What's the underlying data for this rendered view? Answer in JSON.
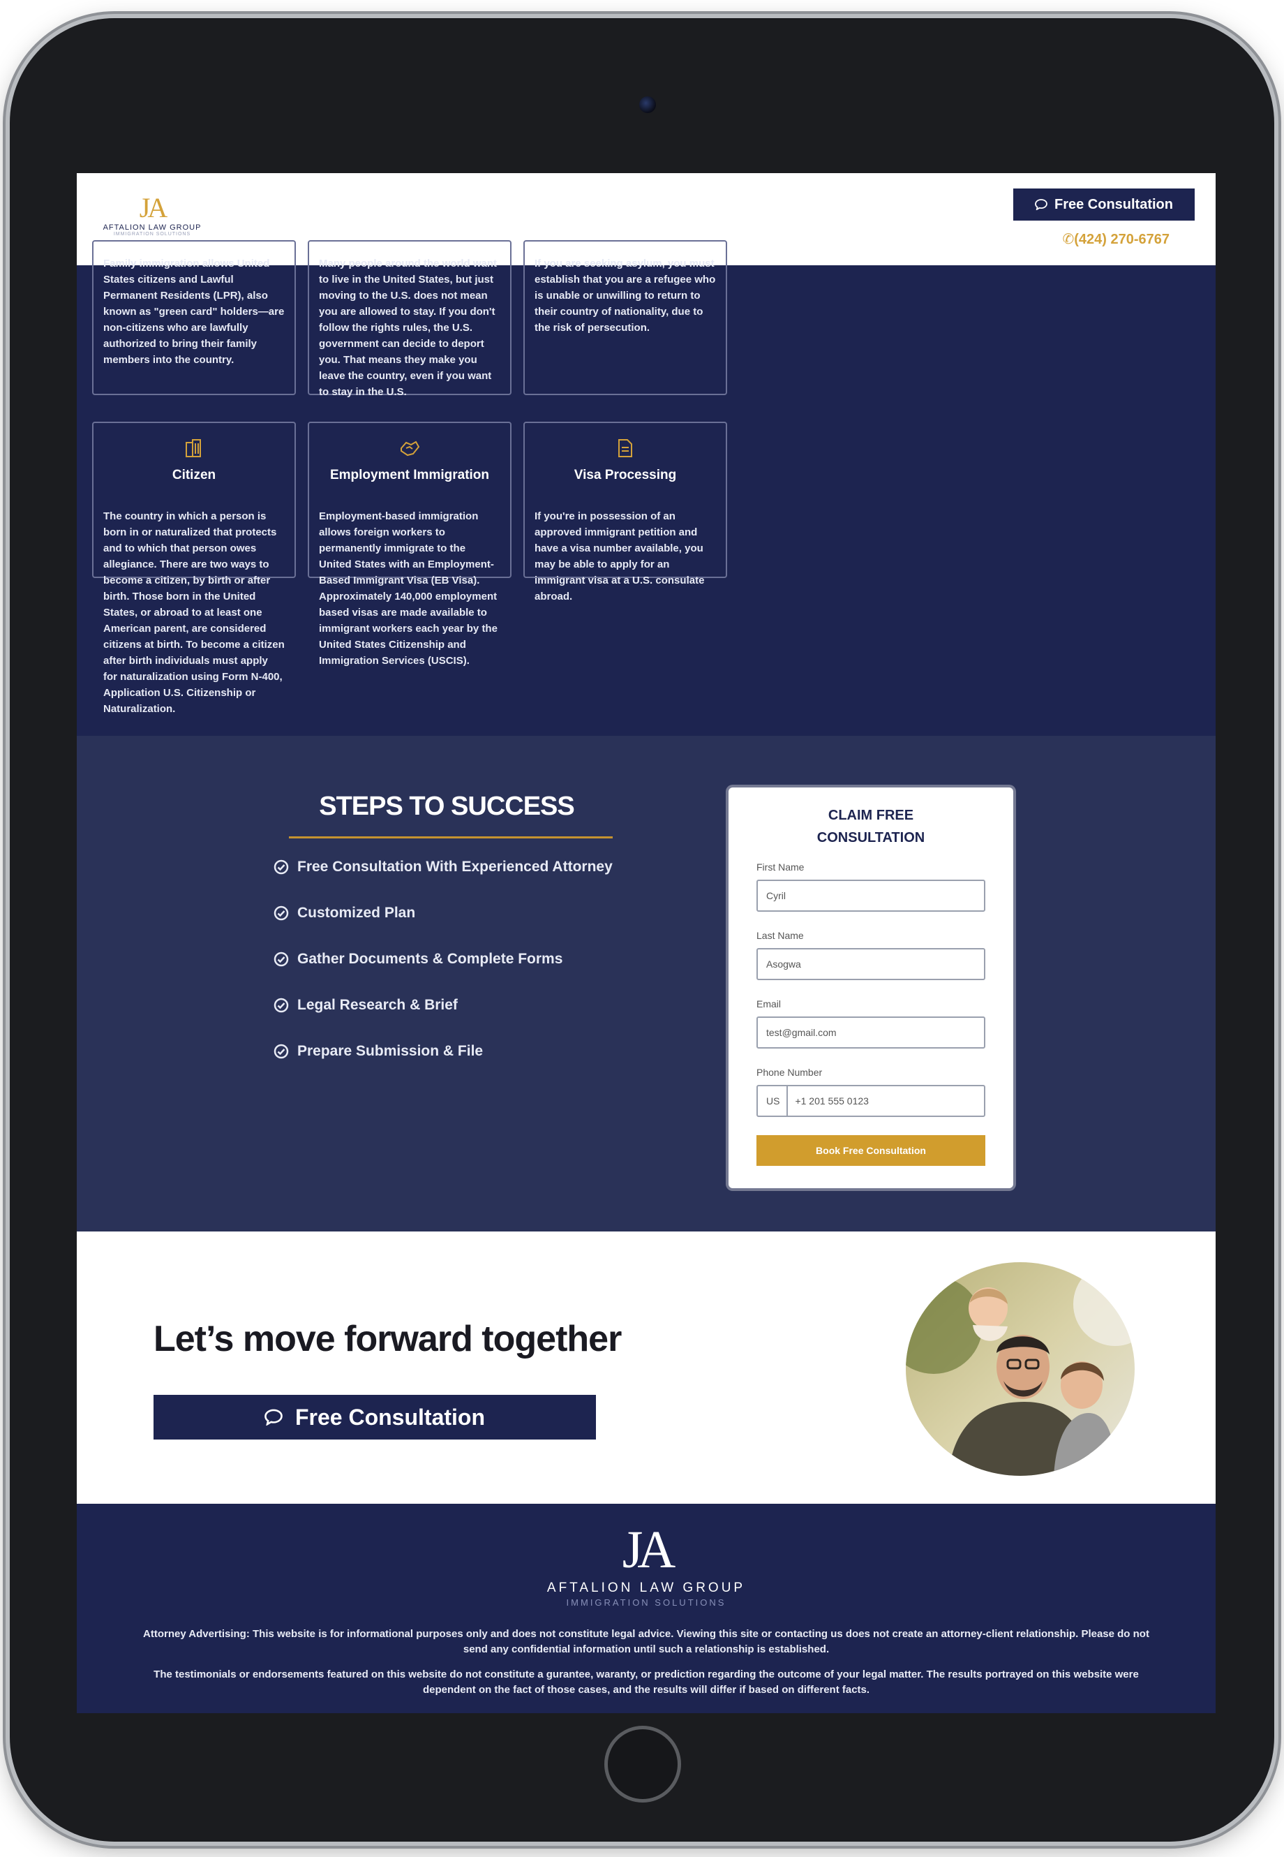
{
  "header": {
    "logo": {
      "mark": "JA",
      "name": "AFTALION LAW GROUP",
      "tagline": "IMMIGRATION SOLUTIONS"
    },
    "cta_label": "Free Consultation",
    "phone": "(424) 270-6767"
  },
  "services": [
    {
      "title": "",
      "text": "Family immigration allows United States citizens and Lawful Permanent Residents (LPR), also known as \"green card\" holders—are non-citizens who are lawfully authorized to bring their family members into the country."
    },
    {
      "title": "",
      "text": "Many people around the world want to live in the United States, but just moving to the U.S. does not mean you are allowed to stay. If you don't follow the rights rules, the U.S. government can decide to deport you. That means they make you leave the country, even if you want to stay in the U.S."
    },
    {
      "title": "",
      "text": "If you are seeking asylum, you must establish that you are a refugee who is unable or unwilling to return to their country of nationality, due to the risk of persecution."
    },
    {
      "title": "Citizen",
      "text": "The country in which a person is born in or naturalized that protects and to which that person owes allegiance. There are two ways to become a citizen, by birth or after birth. Those born in the United States, or abroad to at least one American parent, are considered citizens at birth. To become a citizen after birth individuals must apply for naturalization using Form N-400, Application U.S. Citizenship or Naturalization."
    },
    {
      "title": "Employment Immigration",
      "text": "Employment-based immigration allows foreign workers to permanently immigrate to the United States with an Employment-Based Immigrant Visa (EB Visa). Approximately 140,000 employment based visas are made available to immigrant workers each year by the United States Citizenship and Immigration Services (USCIS)."
    },
    {
      "title": "Visa Processing",
      "text": "If you're in possession of an approved immigrant petition and have a visa number available, you may be able to apply for an immigrant visa at a U.S. consulate abroad."
    }
  ],
  "steps": {
    "title": "STEPS TO SUCCESS",
    "items": [
      "Free Consultation With Experienced Attorney",
      "Customized Plan",
      "Gather Documents & Complete Forms",
      "Legal Research & Brief",
      "Prepare Submission & File"
    ]
  },
  "form": {
    "title_line1": "CLAIM FREE",
    "title_line2": "CONSULTATION",
    "first_name_label": "First Name",
    "first_name_value": "Cyril",
    "last_name_label": "Last Name",
    "last_name_value": "Asogwa",
    "email_label": "Email",
    "email_value": "test@gmail.com",
    "phone_label": "Phone Number",
    "phone_country": "US",
    "phone_value": "+1 201 555 0123",
    "submit_label": "Book Free Consultation"
  },
  "cta": {
    "title": "Let’s move forward together",
    "button_label": "Free Consultation"
  },
  "footer": {
    "logo": {
      "mark": "JA",
      "name": "AFTALION LAW GROUP",
      "tagline": "IMMIGRATION SOLUTIONS"
    },
    "advertising_label": "Attorney Advertising:",
    "advertising_text": "This website is for informational purposes only and does not constitute legal advice. Viewing this site or contacting us does not create an attorney-client relationship. Please do not send any confidential information until such a relationship is established.",
    "disclaimer": "The testimonials or endorsements featured on this website do not constitute a gurantee, waranty, or prediction regarding the outcome of your legal matter. The results portrayed on this website were dependent on the fact of those cases, and the results will differ if based on different facts."
  },
  "colors": {
    "navy": "#1d2450",
    "navy_light": "#2a3258",
    "gold": "#d4a23a",
    "white": "#ffffff"
  }
}
